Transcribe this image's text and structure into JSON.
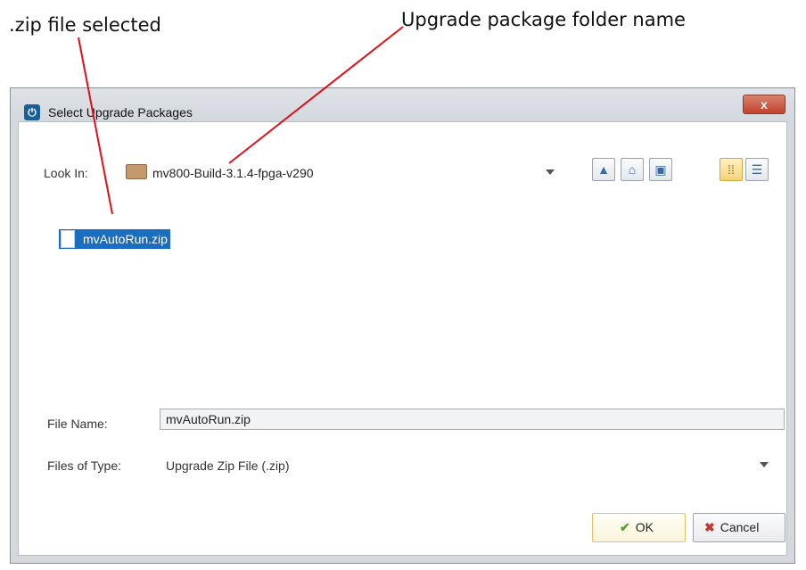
{
  "annotations": {
    "zip_selected": ".zip file selected",
    "folder_name": "Upgrade package folder name"
  },
  "dialog": {
    "title": "Select Upgrade Packages",
    "close_label": "x",
    "look_in_label": "Look In:",
    "look_in_value": "mv800-Build-3.1.4-fpga-v290",
    "toolbar_icons": [
      "up-one-level-icon",
      "home-icon",
      "new-folder-icon",
      "list-view-icon",
      "details-view-icon"
    ],
    "files": [
      {
        "name": "mvAutoRun.zip",
        "selected": true
      }
    ],
    "file_name_label": "File Name:",
    "file_name_value": "mvAutoRun.zip",
    "files_of_type_label": "Files of Type:",
    "files_of_type_value": "Upgrade Zip File (.zip)",
    "ok_label": "OK",
    "cancel_label": "Cancel"
  },
  "colors": {
    "selection": "#1b6dbf",
    "annotation_line": "#e0101a",
    "close_button": "#c0432e"
  }
}
